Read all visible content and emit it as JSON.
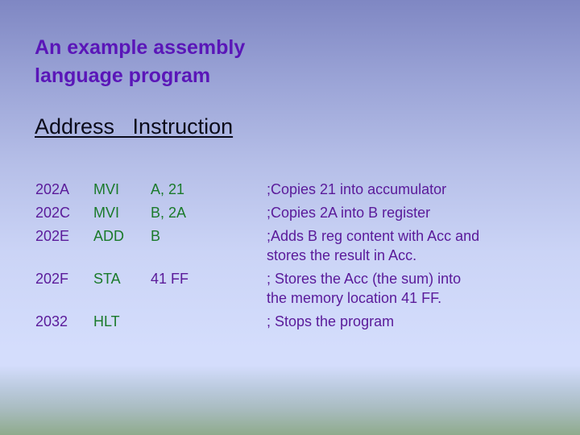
{
  "slide": {
    "title_line1": "An example assembly",
    "title_line2": "language program",
    "header": "Address   Instruction"
  },
  "colors": {
    "title": "#5a16b8",
    "address": "#5a1a9a",
    "mnemonic": "#1a7a2a",
    "comment": "#5a1a9a",
    "header": "#0a0a1a"
  },
  "program": [
    {
      "address": "202A",
      "mnemonic": "MVI",
      "operand": "A, 21",
      "comment": ";Copies 21 into accumulator"
    },
    {
      "address": "202C",
      "mnemonic": "MVI",
      "operand": "B, 2A",
      "comment": ";Copies 2A into B register"
    },
    {
      "address": "202E",
      "mnemonic": "ADD",
      "operand": "B",
      "comment_line1": ";Adds B reg content with Acc and",
      "comment_line2": "stores the result in Acc."
    },
    {
      "address": "202F",
      "mnemonic": "STA",
      "operand": "41 FF",
      "comment_line1": "; Stores the Acc (the sum) into",
      "comment_line2": "the memory location 41 FF."
    },
    {
      "address": "2032",
      "mnemonic": "HLT",
      "operand": "",
      "comment": "; Stops the program"
    }
  ]
}
